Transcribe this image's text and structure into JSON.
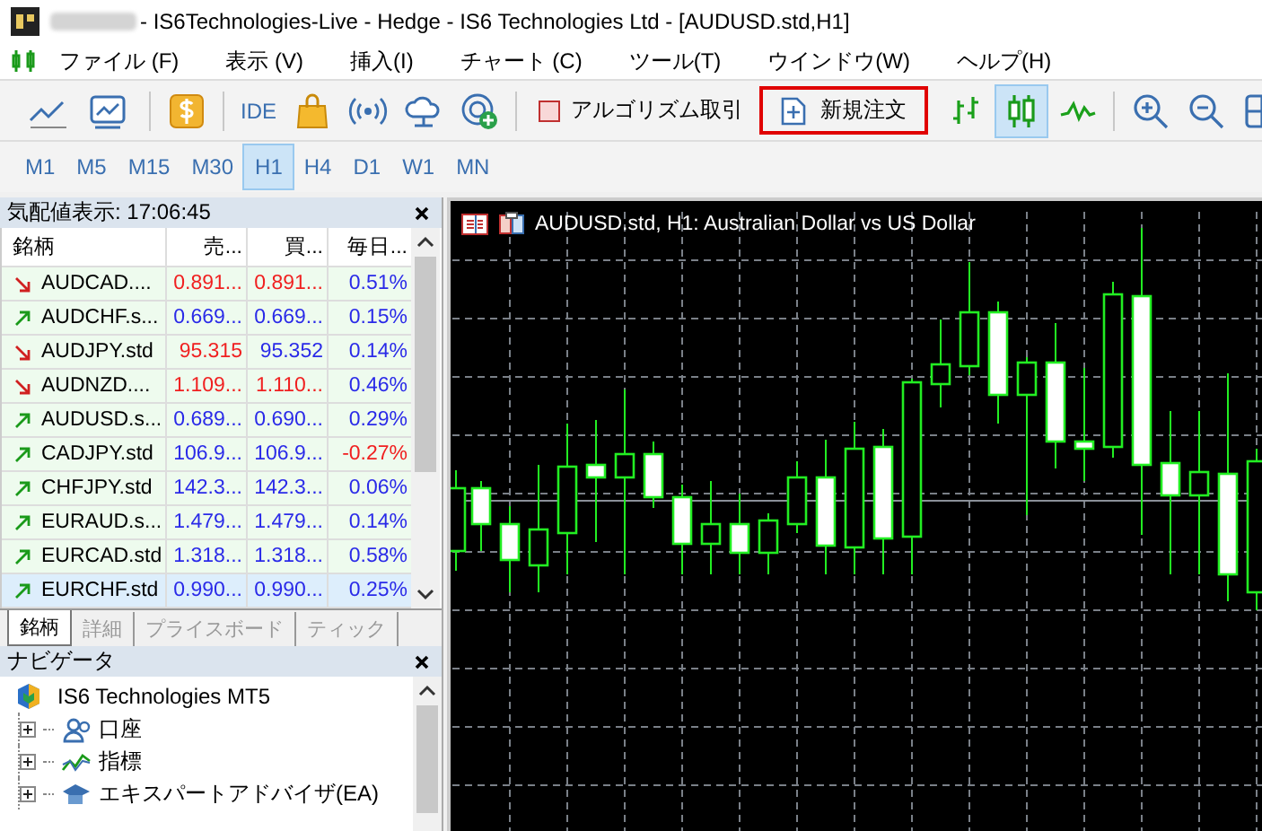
{
  "window": {
    "title": "- IS6Technologies-Live - Hedge - IS6 Technologies Ltd - [AUDUSD.std,H1]"
  },
  "menu": [
    {
      "label": "ファイル (F)"
    },
    {
      "label": "表示 (V)"
    },
    {
      "label": "挿入(I)"
    },
    {
      "label": "チャート (C)"
    },
    {
      "label": "ツール(T)"
    },
    {
      "label": "ウインドウ(W)"
    },
    {
      "label": "ヘルプ(H)"
    }
  ],
  "toolbar": {
    "ide_label": "IDE",
    "algo_trading": {
      "label": "アルゴリズム取引",
      "on": false
    },
    "new_order": {
      "label": "新規注文",
      "highlighted": true
    },
    "chart_types": [
      {
        "kind": "bars",
        "selected": false
      },
      {
        "kind": "candles",
        "selected": true
      },
      {
        "kind": "line",
        "selected": false
      }
    ]
  },
  "timeframes": [
    {
      "label": "M1",
      "selected": false
    },
    {
      "label": "M5",
      "selected": false
    },
    {
      "label": "M15",
      "selected": false
    },
    {
      "label": "M30",
      "selected": false
    },
    {
      "label": "H1",
      "selected": true
    },
    {
      "label": "H4",
      "selected": false
    },
    {
      "label": "D1",
      "selected": false
    },
    {
      "label": "W1",
      "selected": false
    },
    {
      "label": "MN",
      "selected": false
    }
  ],
  "market_watch": {
    "title": "気配値表示: 17:06:45",
    "columns": [
      "銘柄",
      "売...",
      "買...",
      "毎日..."
    ],
    "rows": [
      {
        "rising": false,
        "symbol": "AUDCAD....",
        "bid": "0.891...",
        "bid_rising": false,
        "ask": "0.891...",
        "ask_rising": false,
        "change": "0.51%",
        "change_rising": true,
        "selected": false
      },
      {
        "rising": true,
        "symbol": "AUDCHF.s...",
        "bid": "0.669...",
        "bid_rising": true,
        "ask": "0.669...",
        "ask_rising": true,
        "change": "0.15%",
        "change_rising": true,
        "selected": false
      },
      {
        "rising": false,
        "symbol": "AUDJPY.std",
        "bid": "95.315",
        "bid_rising": false,
        "ask": "95.352",
        "ask_rising": true,
        "change": "0.14%",
        "change_rising": true,
        "selected": false
      },
      {
        "rising": false,
        "symbol": "AUDNZD....",
        "bid": "1.109...",
        "bid_rising": false,
        "ask": "1.110...",
        "ask_rising": false,
        "change": "0.46%",
        "change_rising": true,
        "selected": false
      },
      {
        "rising": true,
        "symbol": "AUDUSD.s...",
        "bid": "0.689...",
        "bid_rising": true,
        "ask": "0.690...",
        "ask_rising": true,
        "change": "0.29%",
        "change_rising": true,
        "selected": false
      },
      {
        "rising": true,
        "symbol": "CADJPY.std",
        "bid": "106.9...",
        "bid_rising": true,
        "ask": "106.9...",
        "ask_rising": true,
        "change": "-0.27%",
        "change_rising": false,
        "selected": false
      },
      {
        "rising": true,
        "symbol": "CHFJPY.std",
        "bid": "142.3...",
        "bid_rising": true,
        "ask": "142.3...",
        "ask_rising": true,
        "change": "0.06%",
        "change_rising": true,
        "selected": false
      },
      {
        "rising": true,
        "symbol": "EURAUD.s...",
        "bid": "1.479...",
        "bid_rising": true,
        "ask": "1.479...",
        "ask_rising": true,
        "change": "0.14%",
        "change_rising": true,
        "selected": false
      },
      {
        "rising": true,
        "symbol": "EURCAD.std",
        "bid": "1.318...",
        "bid_rising": true,
        "ask": "1.318...",
        "ask_rising": true,
        "change": "0.58%",
        "change_rising": true,
        "selected": false
      },
      {
        "rising": true,
        "symbol": "EURCHF.std",
        "bid": "0.990...",
        "bid_rising": true,
        "ask": "0.990...",
        "ask_rising": true,
        "change": "0.25%",
        "change_rising": true,
        "selected": true
      }
    ],
    "tabs": [
      {
        "label": "銘柄",
        "selected": true
      },
      {
        "label": "詳細",
        "selected": false
      },
      {
        "label": "プライスボード",
        "selected": false
      },
      {
        "label": "ティック",
        "selected": false
      }
    ]
  },
  "navigator": {
    "title": "ナビゲータ",
    "tree": [
      {
        "label": "IS6 Technologies MT5",
        "children": [
          {
            "label": "口座",
            "expanded": false
          },
          {
            "label": "指標",
            "expanded": false
          },
          {
            "label": "エキスパートアドバイザ(EA)",
            "expanded": false
          }
        ]
      }
    ]
  },
  "chart": {
    "title": "AUDUSD.std, H1:  Australian Dollar vs US Dollar"
  }
}
